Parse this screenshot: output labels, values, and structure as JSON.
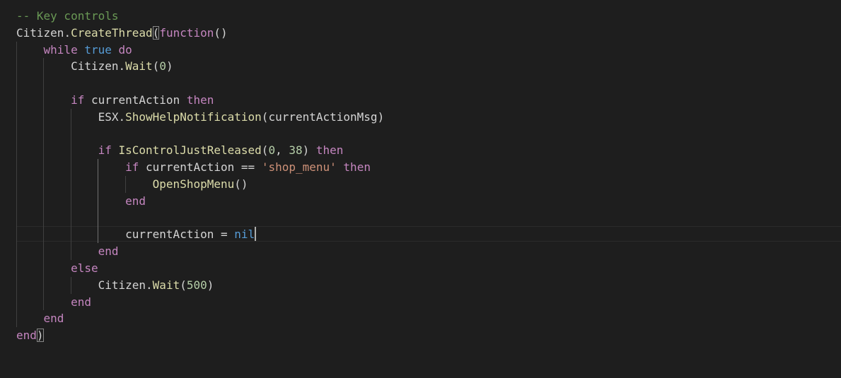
{
  "editor": {
    "language": "lua",
    "colors": {
      "background": "#1e1e1e",
      "comment": "#6a9955",
      "keyword": "#c586c0",
      "constant": "#569cd6",
      "function": "#dcdcaa",
      "number": "#b5cea8",
      "string": "#ce9178",
      "text": "#d4d4d4"
    },
    "lines": [
      "-- Key controls",
      "Citizen.CreateThread(function()",
      "    while true do",
      "        Citizen.Wait(0)",
      "",
      "        if currentAction then",
      "            ESX.ShowHelpNotification(currentActionMsg)",
      "",
      "            if IsControlJustReleased(0, 38) then",
      "                if currentAction == 'shop_menu' then",
      "                    OpenShopMenu()",
      "                end",
      "",
      "                currentAction = nil",
      "            end",
      "        else",
      "            Citizen.Wait(500)",
      "        end",
      "    end",
      "end)"
    ],
    "cursor": {
      "line": 14,
      "column": 36
    }
  }
}
